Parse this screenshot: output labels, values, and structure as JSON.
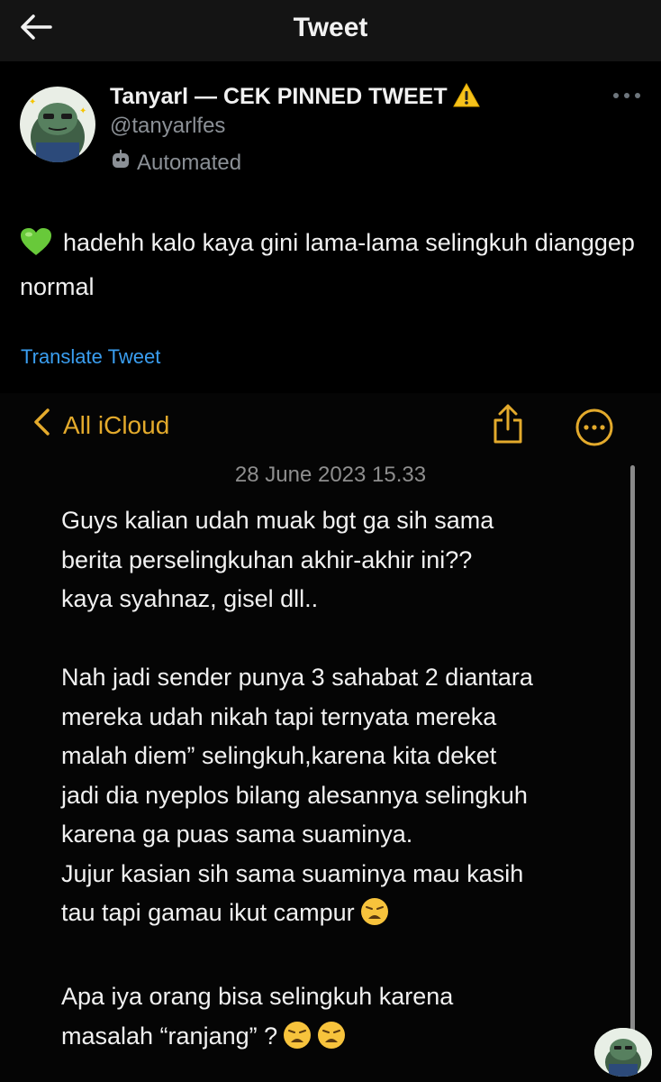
{
  "header": {
    "title": "Tweet",
    "back_icon": "arrow-left-icon"
  },
  "author": {
    "name": "Tanyarl — CEK PINNED TWEET",
    "handle": "@tanyarlfes",
    "automated_label": "Automated",
    "badge_icon": "warning-icon"
  },
  "tweet": {
    "text": "hadehh kalo kaya gini lama-lama selingkuh dianggep normal",
    "translate_label": "Translate Tweet"
  },
  "note": {
    "back_label": "All iCloud",
    "date": "28 June 2023 15.33",
    "paragraph1_line1": "Guys kalian udah muak bgt ga sih sama",
    "paragraph1_line2": "berita perselingkuhan akhir-akhir ini??",
    "paragraph1_line3": "kaya syahnaz, gisel dll..",
    "paragraph2_line1": "Nah jadi sender punya 3 sahabat 2 diantara",
    "paragraph2_line2": "mereka udah nikah tapi ternyata mereka",
    "paragraph2_line3": "malah diem” selingkuh,karena kita deket",
    "paragraph2_line4": "jadi dia nyeplos bilang alesannya selingkuh",
    "paragraph2_line5": "karena ga puas sama suaminya.",
    "paragraph2_line6": "Jujur kasian sih sama suaminya mau kasih",
    "paragraph2_line7": "tau tapi gamau ikut campur",
    "paragraph3_line1": "Apa iya orang bisa selingkuh karena",
    "paragraph3_line2": "masalah “ranjang” ?"
  },
  "colors": {
    "accent_link": "#3a9ef0",
    "notes_accent": "#e3aa2c",
    "background": "#000000"
  }
}
